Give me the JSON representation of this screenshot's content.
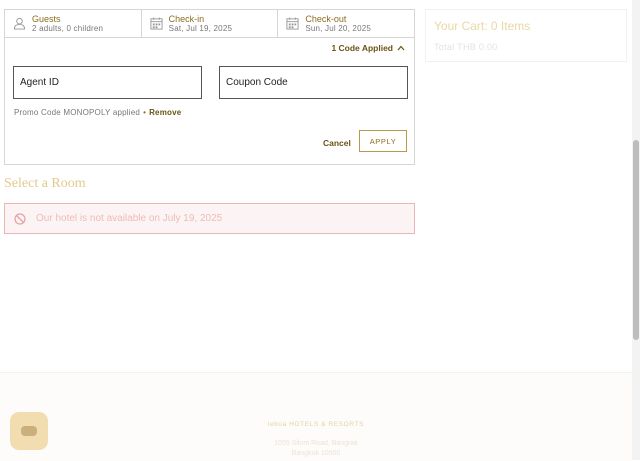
{
  "summary": {
    "guests": {
      "label": "Guests",
      "value": "2 adults, 0 children",
      "icon": "user-icon"
    },
    "checkin": {
      "label": "Check-in",
      "value": "Sat, Jul 19, 2025",
      "icon": "calendar-icon"
    },
    "checkout": {
      "label": "Check-out",
      "value": "Sun, Jul 20, 2025",
      "icon": "calendar-icon"
    }
  },
  "promo": {
    "applied_toggle": "1 Code Applied",
    "agent_placeholder": "Agent ID",
    "coupon_placeholder": "Coupon Code",
    "note": "Promo Code MONOPOLY applied",
    "remove_label": "Remove",
    "cancel_label": "Cancel",
    "apply_label": "APPLY"
  },
  "rooms": {
    "title": "Select a Room",
    "alert": "Our hotel is not available on July 19, 2025"
  },
  "cart": {
    "title": "Your Cart: 0 Items",
    "total": "Total THB 0.00"
  },
  "footer": {
    "brand": "lebua HOTELS & RESORTS",
    "address_line1": "1055 Silom Road, Bangrak",
    "address_line2": "Bangkok 10500"
  },
  "colors": {
    "accent": "#8a6d1d",
    "alert_border": "#e9b7b7",
    "alert_bg": "#fcf4f4",
    "chat_button": "#f2ddb0"
  }
}
